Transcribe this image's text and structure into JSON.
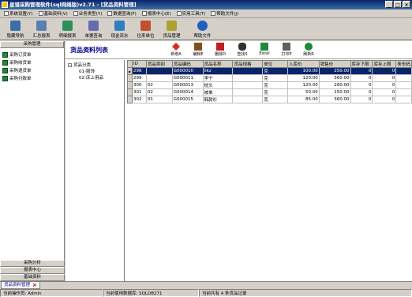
{
  "window": {
    "title": "星谱采购管理软件(sql网络版)v2.71 - [货品资料管理]",
    "min": "_",
    "max": "□",
    "close": "×"
  },
  "menu": [
    {
      "label": "系统设置(Y)"
    },
    {
      "label": "基础资料(V)"
    },
    {
      "label": "业务类型(Y)"
    },
    {
      "label": "数据查询(F)"
    },
    {
      "label": "报表中心(E)"
    },
    {
      "label": "实用工具(T)"
    },
    {
      "label": "帮助文件(J)"
    }
  ],
  "toolbar": [
    {
      "label": "隐藏导航",
      "icon": "hide-nav-icon",
      "color": "#3a6ea5"
    },
    {
      "label": "汇总报表",
      "icon": "summary-report-icon",
      "color": "#5a7fb0"
    },
    {
      "label": "明细报表",
      "icon": "detail-report-icon",
      "color": "#2f8f5a"
    },
    {
      "label": "单据查询",
      "icon": "document-query-icon",
      "color": "#6a6ab0"
    },
    {
      "label": "现金流水",
      "icon": "cash-flow-icon",
      "color": "#3080c0"
    },
    {
      "label": "往来单位",
      "icon": "partner-icon",
      "color": "#c05030"
    },
    {
      "label": "货品管理",
      "icon": "goods-management-icon",
      "color": "#b0a030"
    },
    {
      "label": "帮助文件",
      "icon": "help-icon",
      "color": "#2060c0"
    }
  ],
  "sidebar": {
    "header": "采购管理",
    "items": [
      {
        "label": "采购订货单"
      },
      {
        "label": "采购收货单"
      },
      {
        "label": "采购退货单"
      },
      {
        "label": "采购付款单"
      }
    ],
    "bottom": [
      {
        "label": "采购分析"
      },
      {
        "label": "报表中心"
      },
      {
        "label": "基础资料"
      }
    ]
  },
  "content": {
    "title": "货品资料列表",
    "tools": [
      {
        "label": "新增A",
        "icon": "add-icon",
        "color": "#d03020"
      },
      {
        "label": "编辑E",
        "icon": "edit-icon",
        "color": "#805020"
      },
      {
        "label": "删除D",
        "icon": "delete-icon",
        "color": "#c02020"
      },
      {
        "label": "查找S",
        "icon": "find-icon",
        "color": "#303030"
      },
      {
        "label": "Excel",
        "icon": "excel-icon",
        "color": "#1e8a3a"
      },
      {
        "label": "打印P",
        "icon": "print-icon",
        "color": "#606060"
      },
      {
        "label": "刷新R",
        "icon": "refresh-icon",
        "color": "#1e8a3a"
      }
    ]
  },
  "tree": {
    "root": "货品分类",
    "children": [
      "01-服饰",
      "02-床上用品"
    ]
  },
  "grid": {
    "columns": [
      "ID",
      "货品类别",
      "货品编码",
      "货品名称",
      "货品规格",
      "单位",
      "入库价",
      "销售价",
      "库存下限",
      "库存上限",
      "条形码"
    ],
    "rows": [
      {
        "id": "298",
        "cat": "",
        "code": "G000010",
        "name": "likz",
        "spec": "",
        "unit": "克",
        "in": "100.00",
        "sale": "250.00",
        "min": "0",
        "max": "0",
        "barcode": "",
        "selected": true
      },
      {
        "id": "299",
        "cat": "",
        "code": "G000011",
        "name": "李宁",
        "spec": "",
        "unit": "克",
        "in": "120.00",
        "sale": "360.00",
        "min": "0",
        "max": "0",
        "barcode": "",
        "selected": false
      },
      {
        "id": "300",
        "cat": "02",
        "code": "G000013",
        "name": "枕头",
        "spec": "",
        "unit": "克",
        "in": "120.00",
        "sale": "260.00",
        "min": "0",
        "max": "0",
        "barcode": "",
        "selected": false
      },
      {
        "id": "301",
        "cat": "02",
        "code": "G000014",
        "name": "被单",
        "spec": "",
        "unit": "克",
        "in": "50.00",
        "sale": "150.00",
        "min": "0",
        "max": "0",
        "barcode": "",
        "selected": false
      },
      {
        "id": "302",
        "cat": "01",
        "code": "G000015",
        "name": "韩款衫",
        "spec": "",
        "unit": "克",
        "in": "85.00",
        "sale": "360.00",
        "min": "0",
        "max": "0",
        "barcode": "",
        "selected": false
      }
    ]
  },
  "tabbar": {
    "tab": "货品资料管理",
    "close": "×"
  },
  "status": {
    "operator": "当前操作员: Admin",
    "database": "当前使用数据库: SQLDB271",
    "record": "当前共有 4 条货品记录"
  }
}
